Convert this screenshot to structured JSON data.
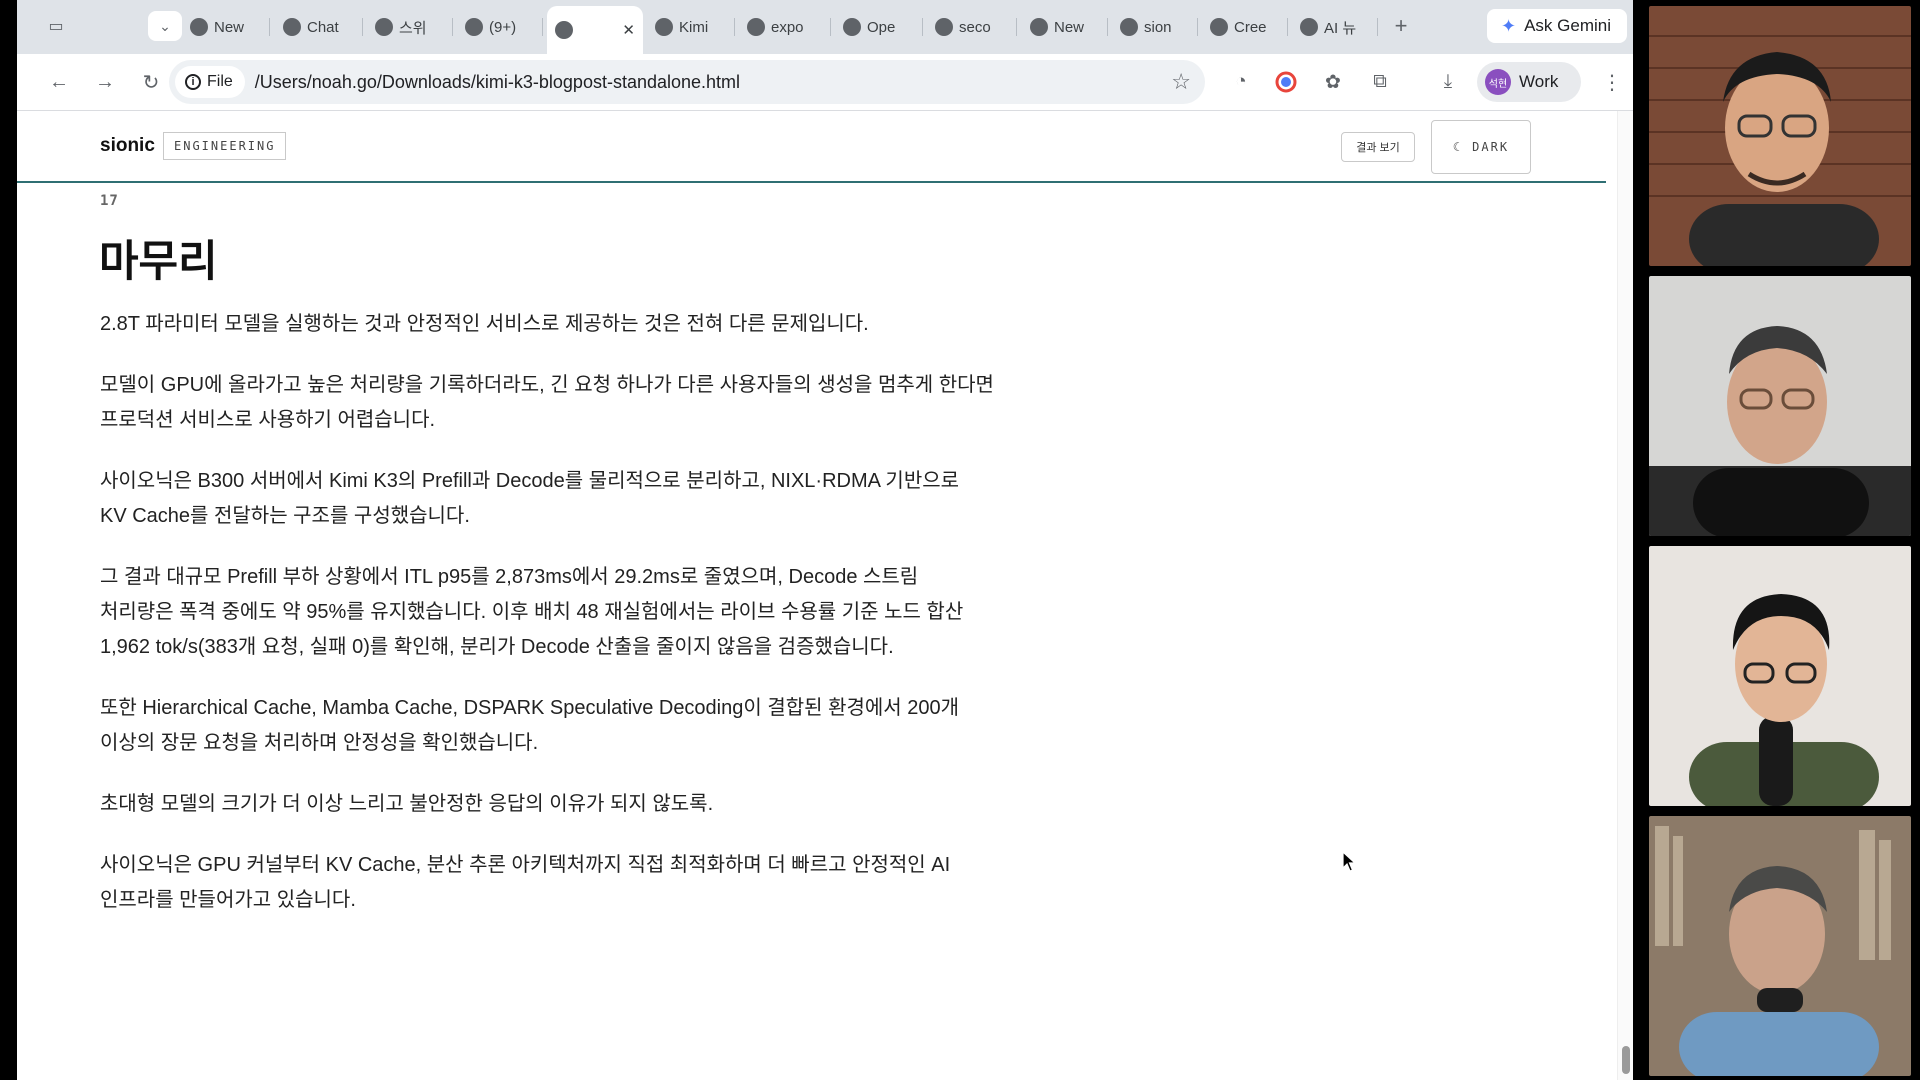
{
  "browser": {
    "tabs": [
      {
        "label": "New",
        "icon": "chrome-icon"
      },
      {
        "label": "Chat",
        "icon": "openai-icon"
      },
      {
        "label": "스위",
        "icon": "swirl-icon"
      },
      {
        "label": "(9+)",
        "icon": "avatar-icon"
      },
      {
        "label": "",
        "icon": "globe-icon",
        "active": true
      },
      {
        "label": "Kimi",
        "icon": "kimi-icon"
      },
      {
        "label": "expo",
        "icon": "globe-icon"
      },
      {
        "label": "Ope",
        "icon": "og-icon"
      },
      {
        "label": "seco",
        "icon": "github-icon"
      },
      {
        "label": "New",
        "icon": "chrome-icon"
      },
      {
        "label": "sion",
        "icon": "github-icon"
      },
      {
        "label": "Cree",
        "icon": "app-icon"
      },
      {
        "label": "AI 뉴",
        "icon": "geeknews-icon"
      }
    ],
    "ask_gemini_label": "Ask Gemini",
    "file_chip_label": "File",
    "url": "/Users/noah.go/Downloads/kimi-k3-blogpost-standalone.html",
    "profile_label": "Work",
    "profile_avatar_text": "석현"
  },
  "site": {
    "brand": "sionic",
    "badge": "ENGINEERING",
    "results_button": "결과 보기",
    "dark_button": "DARK"
  },
  "article": {
    "section_number": "17",
    "section_title": "마무리",
    "paragraphs": [
      {
        "lines": [
          "2.8T 파라미터 모델을 실행하는 것과 안정적인 서비스로 제공하는 것은 전혀 다른 문제입니다."
        ]
      },
      {
        "lines": [
          "모델이 GPU에 올라가고 높은 처리량을 기록하더라도, 긴 요청 하나가 다른 사용자들의 생성을 멈추게 한다면",
          "프로덕션 서비스로 사용하기 어렵습니다."
        ]
      },
      {
        "lines": [
          "사이오닉은 B300 서버에서 Kimi K3의 Prefill과 Decode를 물리적으로 분리하고, NIXL·RDMA 기반으로",
          "KV Cache를 전달하는 구조를 구성했습니다."
        ]
      },
      {
        "lines": [
          "그 결과 대규모 Prefill 부하 상황에서 ITL p95를 2,873ms에서 29.2ms로 줄였으며, Decode 스트림",
          "처리량은 폭격 중에도 약 95%를 유지했습니다. 이후 배치 48 재실험에서는 라이브 수용률 기준 노드 합산",
          "1,962 tok/s(383개 요청, 실패 0)를 확인해, 분리가 Decode 산출을 줄이지 않음을 검증했습니다."
        ]
      },
      {
        "lines": [
          "또한 Hierarchical Cache, Mamba Cache, DSPARK Speculative Decoding이 결합된 환경에서 200개",
          "이상의 장문 요청을 처리하며 안정성을 확인했습니다."
        ]
      },
      {
        "lines": [
          "초대형 모델의 크기가 더 이상 느리고 불안정한 응답의 이유가 되지 않도록."
        ]
      },
      {
        "lines": [
          "사이오닉은 GPU 커널부터 KV Cache, 분산 추론 아키텍처까지 직접 최적화하며 더 빠르고 안정적인 AI",
          "인프라를 만들어가고 있습니다."
        ]
      }
    ]
  },
  "colors": {
    "accent_rule": "#2f6f73",
    "tabstrip": "#dfe3e8",
    "omnibox": "#eef1f4"
  }
}
